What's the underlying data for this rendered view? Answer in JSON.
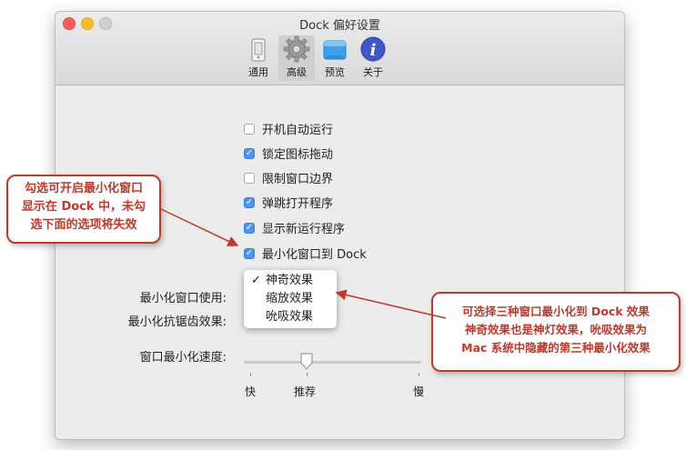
{
  "window": {
    "title": "Dock 偏好设置"
  },
  "toolbar": {
    "items": [
      {
        "label": "通用",
        "icon": "phone-icon"
      },
      {
        "label": "高级",
        "icon": "gear-icon"
      },
      {
        "label": "预览",
        "icon": "window-icon"
      },
      {
        "label": "关于",
        "icon": "info-icon"
      }
    ],
    "active": "高级"
  },
  "checkboxes": [
    {
      "label": "开机自动运行",
      "checked": false
    },
    {
      "label": "锁定图标拖动",
      "checked": true
    },
    {
      "label": "限制窗口边界",
      "checked": false
    },
    {
      "label": "弹跳打开程序",
      "checked": true
    },
    {
      "label": "显示新运行程序",
      "checked": true
    },
    {
      "label": "最小化窗口到 Dock",
      "checked": true
    }
  ],
  "form": {
    "minimize_effect_label": "最小化窗口使用:",
    "antialias_label": "最小化抗锯齿效果:",
    "speed_label": "窗口最小化速度:"
  },
  "effect_menu": {
    "check_mark": "✓",
    "options": [
      "神奇效果",
      "缩放效果",
      "吮吸效果"
    ],
    "selected": "神奇效果"
  },
  "speed_slider": {
    "min_label": "快",
    "mid_label": "推荐",
    "max_label": "慢"
  },
  "annotations": {
    "left": [
      "勾选可开启最小化窗口",
      "显示在 Dock 中，未勾",
      "选下面的选项将失效"
    ],
    "right": [
      "可选择三种窗口最小化到 Dock 效果",
      "神奇效果也是神灯效果，吮吸效果为",
      "Mac 系统中隐藏的第三种最小化效果"
    ]
  },
  "colors": {
    "checkbox_checked": "#4d93f0",
    "annotation_red": "#c0392b",
    "close": "#fc5f57",
    "minimize": "#fdbc2e"
  }
}
